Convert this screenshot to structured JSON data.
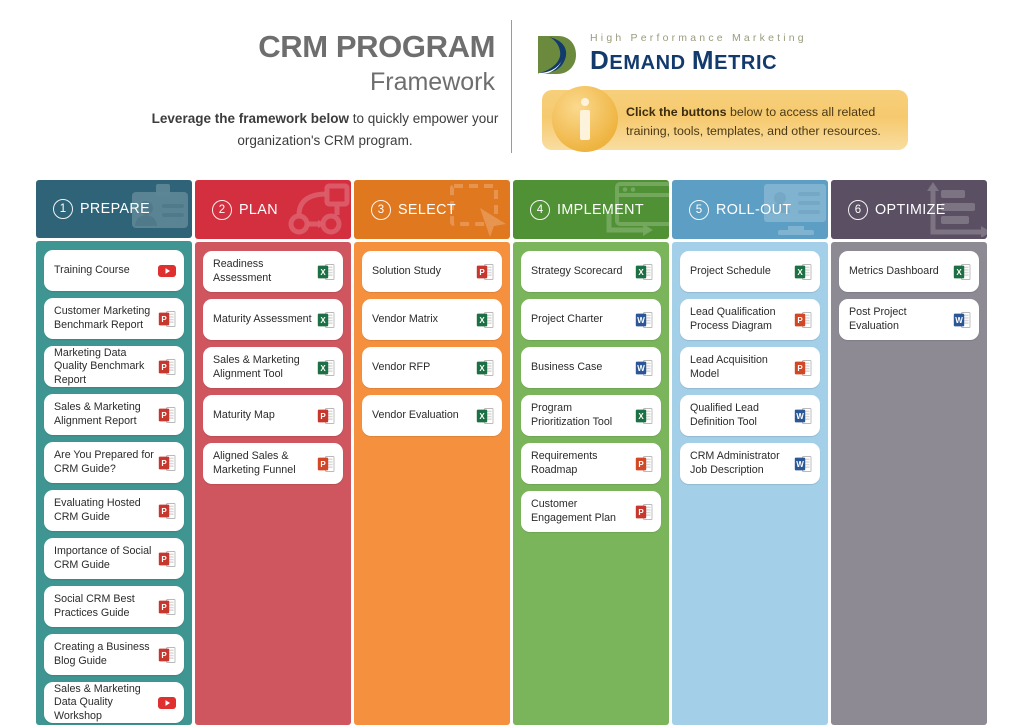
{
  "header": {
    "title_main": "CRM PROGRAM",
    "title_sub": "Framework",
    "lede_bold": "Leverage the framework below",
    "lede_rest": " to quickly empower your organization's CRM program.",
    "logo": {
      "tagline": "High Performance Marketing",
      "name_demand": "D",
      "name_demand_rest": "EMAND ",
      "name_metric": "M",
      "name_metric_rest": "ETRIC",
      "mark_icon": "demand-metric-swoosh-icon",
      "brand_color": "#123a6d",
      "tag_color": "#9b9b7e"
    },
    "callout": {
      "icon": "info-icon",
      "bold": "Click the buttons",
      "rest": " below to access all related training, tools, templates, and other resources.",
      "bg_color": "#f6c96e"
    }
  },
  "board": {
    "columns": [
      {
        "number": "1",
        "name": "PREPARE",
        "icon": "id-card-icon",
        "head_color": "#2e6378",
        "body_color": "#3e9591",
        "items": [
          {
            "label": "Training Course",
            "file": "youtube"
          },
          {
            "label": "Customer Marketing Benchmark Report",
            "file": "pdf"
          },
          {
            "label": "Marketing Data Quality Benchmark Report",
            "file": "pdf"
          },
          {
            "label": "Sales & Marketing Alignment Report",
            "file": "pdf"
          },
          {
            "label": "Are You Prepared for CRM Guide?",
            "file": "pdf"
          },
          {
            "label": "Evaluating Hosted CRM Guide",
            "file": "pdf"
          },
          {
            "label": "Importance of Social CRM Guide",
            "file": "pdf"
          },
          {
            "label": "Social CRM Best Practices Guide",
            "file": "pdf"
          },
          {
            "label": "Creating a Business Blog Guide",
            "file": "pdf"
          },
          {
            "label": "Sales & Marketing Data Quality Workshop",
            "file": "youtube"
          }
        ]
      },
      {
        "number": "2",
        "name": "PLAN",
        "icon": "process-flow-icon",
        "head_color": "#d32f3f",
        "body_color": "#cf555f",
        "items": [
          {
            "label": "Readiness Assessment",
            "file": "excel"
          },
          {
            "label": "Maturity Assessment",
            "file": "excel"
          },
          {
            "label": "Sales & Marketing Alignment Tool",
            "file": "excel"
          },
          {
            "label": "Maturity Map",
            "file": "pdf"
          },
          {
            "label": "Aligned Sales & Marketing Funnel",
            "file": "powerpoint"
          }
        ]
      },
      {
        "number": "3",
        "name": "SELECT",
        "icon": "selection-cursor-icon",
        "head_color": "#e07820",
        "body_color": "#f5913e",
        "items": [
          {
            "label": "Solution Study",
            "file": "pdf"
          },
          {
            "label": "Vendor Matrix",
            "file": "excel"
          },
          {
            "label": "Vendor RFP",
            "file": "excel"
          },
          {
            "label": "Vendor Evaluation",
            "file": "excel"
          }
        ]
      },
      {
        "number": "4",
        "name": "IMPLEMENT",
        "icon": "browser-window-icon",
        "head_color": "#4f9134",
        "body_color": "#7ab55c",
        "items": [
          {
            "label": "Strategy Scorecard",
            "file": "excel"
          },
          {
            "label": "Project Charter",
            "file": "word"
          },
          {
            "label": "Business Case",
            "file": "word"
          },
          {
            "label": "Program Prioritization Tool",
            "file": "excel"
          },
          {
            "label": "Requirements Roadmap",
            "file": "powerpoint"
          },
          {
            "label": "Customer Engagement Plan",
            "file": "pdf"
          }
        ]
      },
      {
        "number": "5",
        "name": "ROLL-OUT",
        "icon": "monitor-profile-icon",
        "head_color": "#5d9fc4",
        "body_color": "#a3cfe8",
        "items": [
          {
            "label": "Project Schedule",
            "file": "excel"
          },
          {
            "label": "Lead Qualification Process Diagram",
            "file": "powerpoint"
          },
          {
            "label": "Lead Acquisition Model",
            "file": "powerpoint"
          },
          {
            "label": "Qualified Lead Definition Tool",
            "file": "word"
          },
          {
            "label": "CRM Administrator Job Description",
            "file": "word"
          }
        ]
      },
      {
        "number": "6",
        "name": "OPTIMIZE",
        "icon": "growth-arrows-icon",
        "head_color": "#5a4f63",
        "body_color": "#8e8a94",
        "items": [
          {
            "label": "Metrics Dashboard",
            "file": "excel"
          },
          {
            "label": "Post Project Evaluation",
            "file": "word"
          }
        ]
      }
    ]
  },
  "file_colors": {
    "pdf": "#c8372d",
    "excel": "#1d7044",
    "word": "#2b5797",
    "powerpoint": "#d24726",
    "youtube": "#e02f2f"
  }
}
